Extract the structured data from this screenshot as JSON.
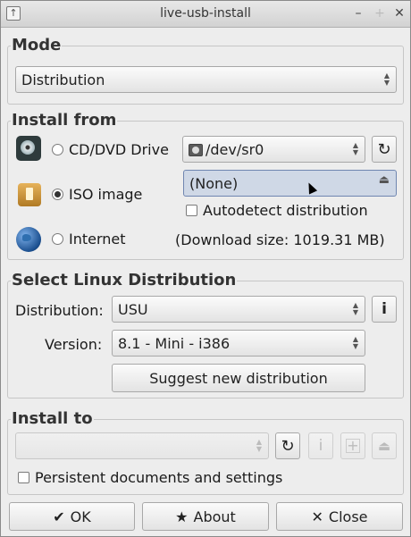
{
  "window": {
    "title": "live-usb-install"
  },
  "mode": {
    "title": "Mode",
    "selected": "Distribution"
  },
  "install_from": {
    "title": "Install from",
    "cd_label": "CD/DVD Drive",
    "iso_label": "ISO image",
    "internet_label": "Internet",
    "selected_option": "ISO image",
    "drive_value": "/dev/sr0",
    "iso_value": "(None)",
    "autodetect_label": "Autodetect distribution",
    "download_size": "(Download size: 1019.31 MB)"
  },
  "select_distro": {
    "title": "Select Linux Distribution",
    "distribution_label": "Distribution:",
    "distribution_value": "USU",
    "version_label": "Version:",
    "version_value": "8.1 - Mini - i386",
    "suggest_label": "Suggest new distribution"
  },
  "install_to": {
    "title": "Install to",
    "target_value": "",
    "persistent_label": "Persistent documents and settings"
  },
  "footer": {
    "ok_label": "OK",
    "about_label": "About",
    "close_label": "Close"
  },
  "icons": {
    "refresh": "↻",
    "info": "i",
    "eject": "⏏",
    "plus": "+",
    "check": "✔",
    "star": "★",
    "x": "✕"
  }
}
